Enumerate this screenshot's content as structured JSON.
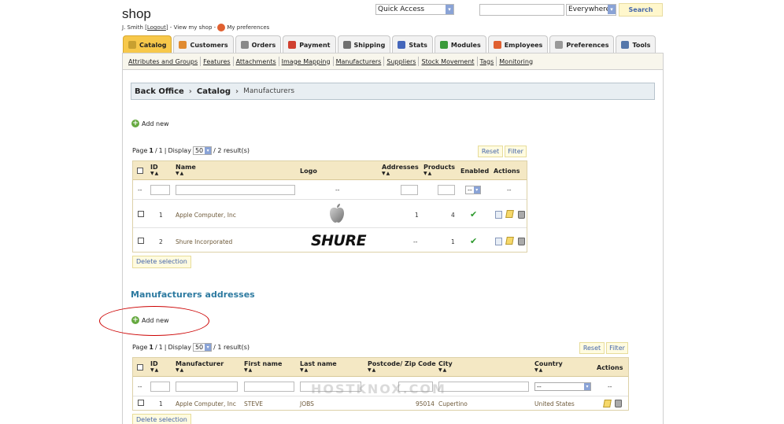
{
  "header": {
    "shop_title": "shop",
    "user_name": "J. Smith",
    "logout_label": "Logout",
    "view_shop_label": "View my shop",
    "preferences_label": "My preferences",
    "quick_access": "Quick Access",
    "search_scope": "Everywhere",
    "search_button": "Search"
  },
  "tabs": [
    {
      "label": "Catalog",
      "icon": "catalog-icon",
      "active": true,
      "color": "#c8a030"
    },
    {
      "label": "Customers",
      "icon": "customers-icon",
      "active": false,
      "color": "#e08a30"
    },
    {
      "label": "Orders",
      "icon": "orders-icon",
      "active": false,
      "color": "#888888"
    },
    {
      "label": "Payment",
      "icon": "payment-icon",
      "active": false,
      "color": "#d04030"
    },
    {
      "label": "Shipping",
      "icon": "shipping-icon",
      "active": false,
      "color": "#707070"
    },
    {
      "label": "Stats",
      "icon": "stats-icon",
      "active": false,
      "color": "#4466bb"
    },
    {
      "label": "Modules",
      "icon": "modules-icon",
      "active": false,
      "color": "#3a9a3a"
    },
    {
      "label": "Employees",
      "icon": "employees-icon",
      "active": false,
      "color": "#e06030"
    },
    {
      "label": "Preferences",
      "icon": "preferences-icon",
      "active": false,
      "color": "#999999"
    },
    {
      "label": "Tools",
      "icon": "tools-icon",
      "active": false,
      "color": "#5577aa"
    }
  ],
  "subnav": [
    "Attributes and Groups",
    "Features",
    "Attachments",
    "Image Mapping",
    "Manufacturers",
    "Suppliers",
    "Stock Movement",
    "Tags",
    "Monitoring"
  ],
  "breadcrumb": {
    "root": "Back Office",
    "section": "Catalog",
    "current": "Manufacturers"
  },
  "manufacturers": {
    "add_new": "Add new",
    "page_label": "Page",
    "page_current": "1",
    "page_total": "1",
    "display_label": "Display",
    "display_value": "50",
    "results": "/ 2 result(s)",
    "reset": "Reset",
    "filter": "Filter",
    "columns": [
      "ID",
      "Name",
      "Logo",
      "Addresses",
      "Products",
      "Enabled",
      "Actions"
    ],
    "filter_placeholder": "--",
    "enabled_filter": "--",
    "rows": [
      {
        "id": "1",
        "name": "Apple Computer, Inc",
        "logo": "apple-logo",
        "addresses": "1",
        "products": "4"
      },
      {
        "id": "2",
        "name": "Shure Incorporated",
        "logo": "SHURE",
        "addresses": "--",
        "products": "1"
      }
    ],
    "delete_selection": "Delete selection"
  },
  "addresses": {
    "title": "Manufacturers addresses",
    "add_new": "Add new",
    "page_label": "Page",
    "page_current": "1",
    "page_total": "1",
    "display_label": "Display",
    "display_value": "50",
    "results": "/ 1 result(s)",
    "reset": "Reset",
    "filter": "Filter",
    "columns": [
      "ID",
      "Manufacturer",
      "First name",
      "Last name",
      "Postcode/ Zip Code",
      "City",
      "Country",
      "Actions"
    ],
    "filter_placeholder": "--",
    "country_filter": "--",
    "rows": [
      {
        "id": "1",
        "manufacturer": "Apple Computer, Inc",
        "first_name": "STEVE",
        "last_name": "JOBS",
        "postcode": "95014",
        "city": "Cupertino",
        "country": "United States"
      }
    ],
    "delete_selection": "Delete selection"
  },
  "watermark": "HOSTKNOX.COM"
}
